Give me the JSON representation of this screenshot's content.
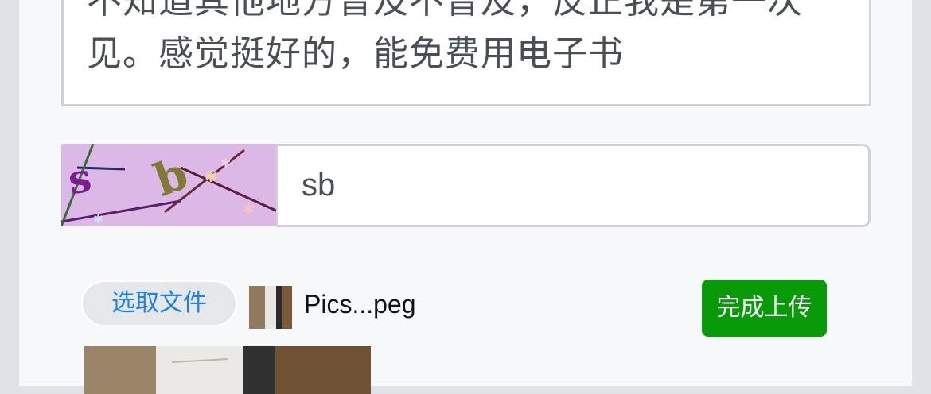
{
  "comment": {
    "text": "不知道其他地方普及不普及，反正我是第一次见。感觉挺好的，能免费用电子书"
  },
  "captcha": {
    "image_label": "captcha-image",
    "input_value": "sb"
  },
  "upload": {
    "choose_file_label": "选取文件",
    "file_name": "Pics...peg",
    "submit_label": "完成上传"
  },
  "colors": {
    "accent_blue": "#1a82e8",
    "upload_green": "#089a08",
    "captcha_bg": "#dcb8e6"
  }
}
